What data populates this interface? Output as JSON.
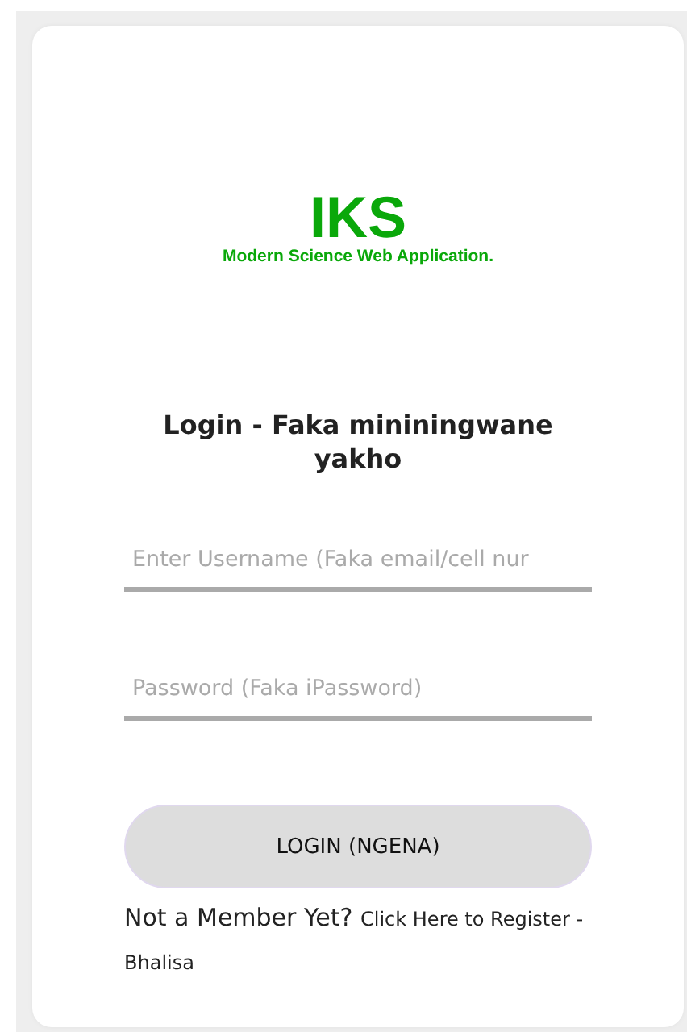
{
  "logo": {
    "title": "IKS",
    "tagline": "Modern Science Web Application."
  },
  "heading": "Login - Faka mininingwane yakho",
  "username_field": {
    "placeholder": "Enter Username (Faka email/cell nur"
  },
  "password_field": {
    "placeholder": "Password (Faka iPassword)"
  },
  "login_button": "LOGIN (NGENA)",
  "register": {
    "prompt": "Not a Member Yet?",
    "link": "Click Here to Register -Bhalisa"
  }
}
